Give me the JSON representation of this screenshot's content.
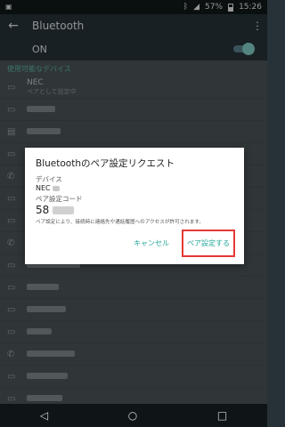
{
  "status_bar": {
    "battery_text": "57%",
    "time": "15:26"
  },
  "app_bar": {
    "title": "Bluetooth"
  },
  "toggle": {
    "label": "ON",
    "state": "on"
  },
  "available_devices": {
    "header": "使用可能なデバイス",
    "items": [
      {
        "name": "NEC",
        "sub": "ペアとして設定中",
        "icon": "laptop-icon"
      },
      {
        "name": "",
        "icon": "laptop-icon"
      },
      {
        "name": "",
        "icon": "keyboard-icon"
      },
      {
        "name": "",
        "icon": "laptop-icon"
      },
      {
        "name": "",
        "icon": "phone-icon"
      },
      {
        "name": "",
        "icon": "laptop-icon"
      },
      {
        "name": "",
        "icon": "laptop-icon"
      },
      {
        "name": "",
        "icon": "phone-icon"
      },
      {
        "name": "",
        "icon": "laptop-icon"
      },
      {
        "name": "",
        "icon": "laptop-icon"
      },
      {
        "name": "",
        "icon": "laptop-icon"
      },
      {
        "name": "",
        "icon": "laptop-icon"
      },
      {
        "name": "",
        "icon": "phone-icon"
      },
      {
        "name": "",
        "icon": "laptop-icon"
      },
      {
        "name": "",
        "icon": "laptop-icon"
      }
    ]
  },
  "dialog": {
    "title": "Bluetoothのペア設定リクエスト",
    "device_label": "デバイス",
    "device_value": "NEC",
    "code_label": "ペア設定コード",
    "code_value": "58",
    "note": "ペア設定により、接続時に連絡先や通話履歴へのアクセスが許可されます。",
    "cancel_label": "キャンセル",
    "pair_label": "ペア設定する"
  },
  "colors": {
    "accent": "#26a69a",
    "highlight_box": "#e53935"
  }
}
